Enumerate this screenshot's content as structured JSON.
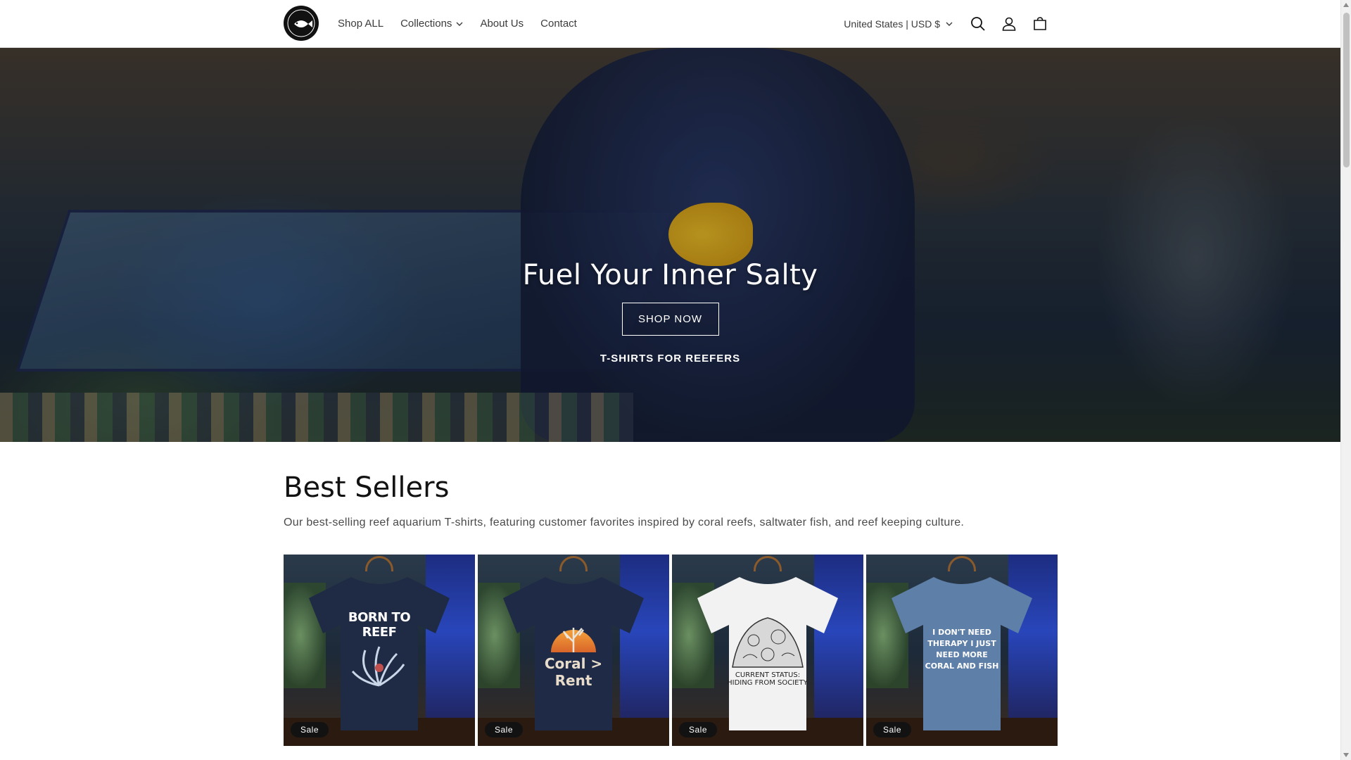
{
  "header": {
    "nav": [
      {
        "label": "Shop ALL",
        "has_dropdown": false
      },
      {
        "label": "Collections",
        "has_dropdown": true
      },
      {
        "label": "About Us",
        "has_dropdown": false
      },
      {
        "label": "Contact",
        "has_dropdown": false
      }
    ],
    "country_selector": "United States | USD $",
    "icons": [
      "search-icon",
      "account-icon",
      "cart-icon"
    ]
  },
  "hero": {
    "title": "Fuel Your Inner Salty",
    "button_label": "SHOP NOW",
    "subtitle": "T-SHIRTS FOR REEFERS"
  },
  "best_sellers": {
    "title": "Best Sellers",
    "description": "Our best-selling reef aquarium T-shirts, featuring customer favorites inspired by coral reefs, saltwater fish, and reef keeping culture.",
    "products": [
      {
        "shirt_color": "#1f2a44",
        "print_text": "BORN TO REEF",
        "badge": "Sale"
      },
      {
        "shirt_color": "#1e2a46",
        "print_text": "Coral > Rent",
        "badge": "Sale"
      },
      {
        "shirt_color": "#f2f2f2",
        "print_text": "CURRENT STATUS: HIDING FROM SOCIETY.",
        "badge": "Sale"
      },
      {
        "shirt_color": "#5d7fa8",
        "print_text": "I DON'T NEED THERAPY I JUST NEED MORE CORAL AND FISH",
        "badge": "Sale"
      }
    ]
  },
  "colors": {
    "accent": "#121212",
    "hero_text": "#ffffff"
  }
}
